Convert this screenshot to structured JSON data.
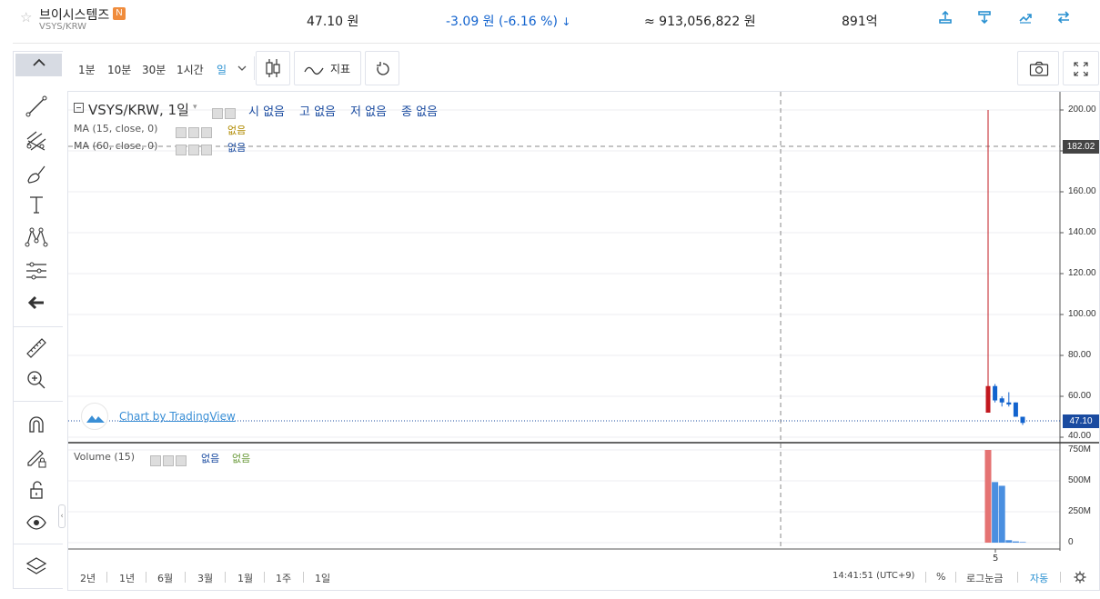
{
  "header": {
    "coin_name": "브이시스템즈",
    "badge": "N",
    "pair": "VSYS/KRW",
    "price": "47.10 원",
    "change": "-3.09 원 (-6.16 %)",
    "change_arrow": "↓",
    "volume": "≈ 913,056,822 원",
    "market_cap": "891억",
    "icons": [
      "share-icon",
      "download-icon",
      "trend-icon",
      "exchange-icon"
    ]
  },
  "toolbar": {
    "intervals": [
      "1분",
      "10분",
      "30분",
      "1시간",
      "일"
    ],
    "selected_interval": "일",
    "indicator_label": "지표"
  },
  "chart": {
    "symbol_title": "VSYS/KRW, 1일",
    "ohlc": [
      "시 없음",
      "고 없음",
      "저 없음",
      "종 없음"
    ],
    "ma1_label": "MA (15, close, 0)",
    "ma1_value": "없음",
    "ma2_label": "MA (60, close, 0)",
    "ma2_value": "없음",
    "volume_label": "Volume (15)",
    "volume_val1": "없음",
    "volume_val2": "없음",
    "watermark": "Chart by TradingView",
    "price_axis": [
      "200.00",
      "180.00",
      "160.00",
      "140.00",
      "120.00",
      "100.00",
      "80.00",
      "60.00",
      "40.00"
    ],
    "volume_axis": [
      "750M",
      "500M",
      "250M",
      "0"
    ],
    "crosshair_price": "182.02",
    "last_price": "47.10",
    "time_label": "5"
  },
  "bottom_bar": {
    "ranges": [
      "2년",
      "1년",
      "6월",
      "3월",
      "1월",
      "1주",
      "1일"
    ],
    "clock": "14:41:51 (UTC+9)",
    "percent": "%",
    "log": "로그눈금",
    "auto": "자동"
  },
  "chart_data": {
    "type": "candlestick",
    "candles": [
      {
        "o": 65,
        "h": 200,
        "l": 52,
        "c": 52,
        "dir": "down-red",
        "vol": 750
      },
      {
        "o": 58,
        "h": 66,
        "l": 57,
        "c": 65,
        "dir": "up",
        "vol": 490
      },
      {
        "o": 59,
        "h": 60,
        "l": 55,
        "c": 57,
        "dir": "up",
        "vol": 460
      },
      {
        "o": 57,
        "h": 62,
        "l": 55,
        "c": 56,
        "dir": "up",
        "vol": 20
      },
      {
        "o": 57,
        "h": 57,
        "l": 50,
        "c": 50,
        "dir": "up",
        "vol": 10
      },
      {
        "o": 50,
        "h": 50,
        "l": 46,
        "c": 47,
        "dir": "up",
        "vol": 5
      }
    ],
    "ylim": [
      40,
      200
    ],
    "vol_lim_m": [
      0,
      750
    ]
  },
  "colors": {
    "accent": "#2a91d1",
    "down_blue": "#1263ce",
    "red_candle": "#c2181f",
    "vol_red": "#e57373",
    "vol_blue": "#4a8fe0"
  }
}
